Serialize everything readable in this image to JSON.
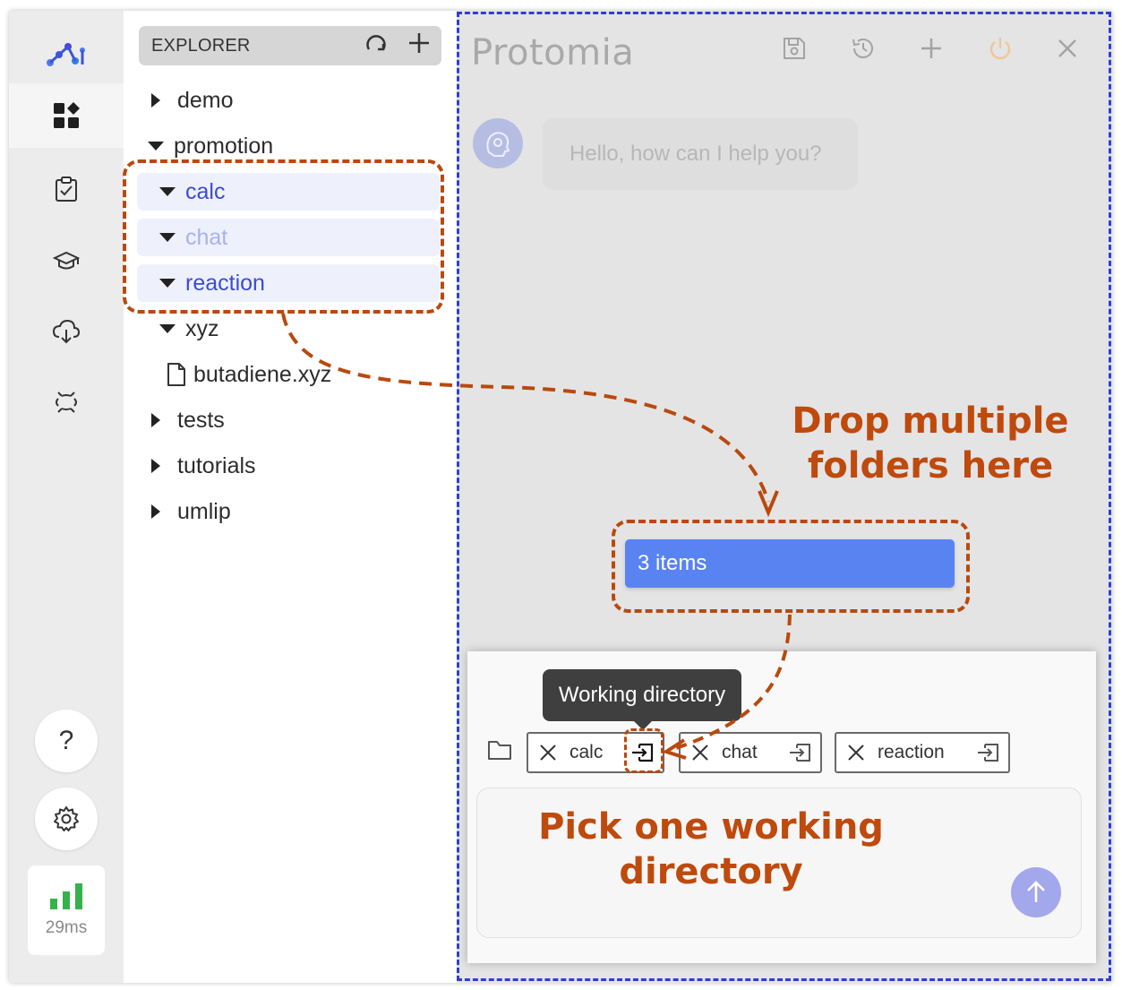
{
  "activity_bar": {
    "items": [
      {
        "icon": "dashboard-icon",
        "active": true
      },
      {
        "icon": "clipboard-check-icon",
        "active": false
      },
      {
        "icon": "graduation-cap-icon",
        "active": false
      },
      {
        "icon": "cloud-download-icon",
        "active": false
      },
      {
        "icon": "brackets-icon",
        "active": false
      }
    ],
    "help_label": "?",
    "latency": "29ms"
  },
  "explorer": {
    "title": "EXPLORER",
    "tree": {
      "demo": "demo",
      "promotion": "promotion",
      "calc": "calc",
      "chat": "chat",
      "reaction": "reaction",
      "xyz": "xyz",
      "file": "butadiene.xyz",
      "tests": "tests",
      "tutorials": "tutorials",
      "umlip": "umlip"
    }
  },
  "chat": {
    "title": "Protomia",
    "greeting": "Hello, how can I help you?",
    "drag_label": "3 items",
    "tooltip": "Working directory",
    "tags": [
      "calc",
      "chat",
      "reaction"
    ]
  },
  "annotations": {
    "drop_line1": "Drop multiple",
    "drop_line2": "folders here",
    "pick_line1": "Pick one working",
    "pick_line2": "directory"
  },
  "colors": {
    "accent": "#5a83f2",
    "annotation": "#bf4a0d",
    "drop_outline": "#2f3fd0",
    "selected_text": "#3b4bd0"
  }
}
